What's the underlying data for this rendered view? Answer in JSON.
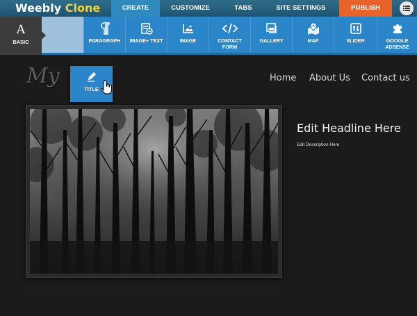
{
  "app": {
    "logo_word": "Weebly",
    "logo_accent": "Clone",
    "colors": {
      "topbar": "#1f5572",
      "active_tab": "#2f8bbd",
      "publish": "#e8622a",
      "toolbar": "#2a86c8",
      "logo_accent": "#f3d23a"
    }
  },
  "topnav": {
    "tabs": [
      {
        "label": "CREATE",
        "active": true
      },
      {
        "label": "CUSTOMIZE",
        "active": false
      },
      {
        "label": "TABS",
        "active": false
      },
      {
        "label": "SITE SETTINGS",
        "active": false
      }
    ],
    "publish_label": "PUBLISH",
    "menu_icon": "list-icon"
  },
  "toolbar": {
    "category": {
      "glyph": "A",
      "label": "BASIC"
    },
    "elements": [
      {
        "label": "PARAGRAPH",
        "icon": "paragraph-icon"
      },
      {
        "label": "IMAGE+ TEXT",
        "icon": "image-text-icon"
      },
      {
        "label": "IMAGE",
        "icon": "image-icon"
      },
      {
        "label": "CONTACT FORM",
        "icon": "code-icon"
      },
      {
        "label": "GALLERY",
        "icon": "gallery-icon"
      },
      {
        "label": "MAP",
        "icon": "map-icon"
      },
      {
        "label": "SLIDER",
        "icon": "slider-icon"
      },
      {
        "label": "GOOGLE ADSENSE",
        "icon": "puzzle-icon"
      }
    ]
  },
  "site": {
    "title_partial": "My",
    "dragging_element": {
      "label": "TITLE",
      "icon": "pencil-icon"
    },
    "nav": [
      "Home",
      "About Us",
      "Contact us"
    ],
    "headline": "Edit Headline Here",
    "description": "Edit Description Here",
    "image_icon": "forest-photo"
  }
}
